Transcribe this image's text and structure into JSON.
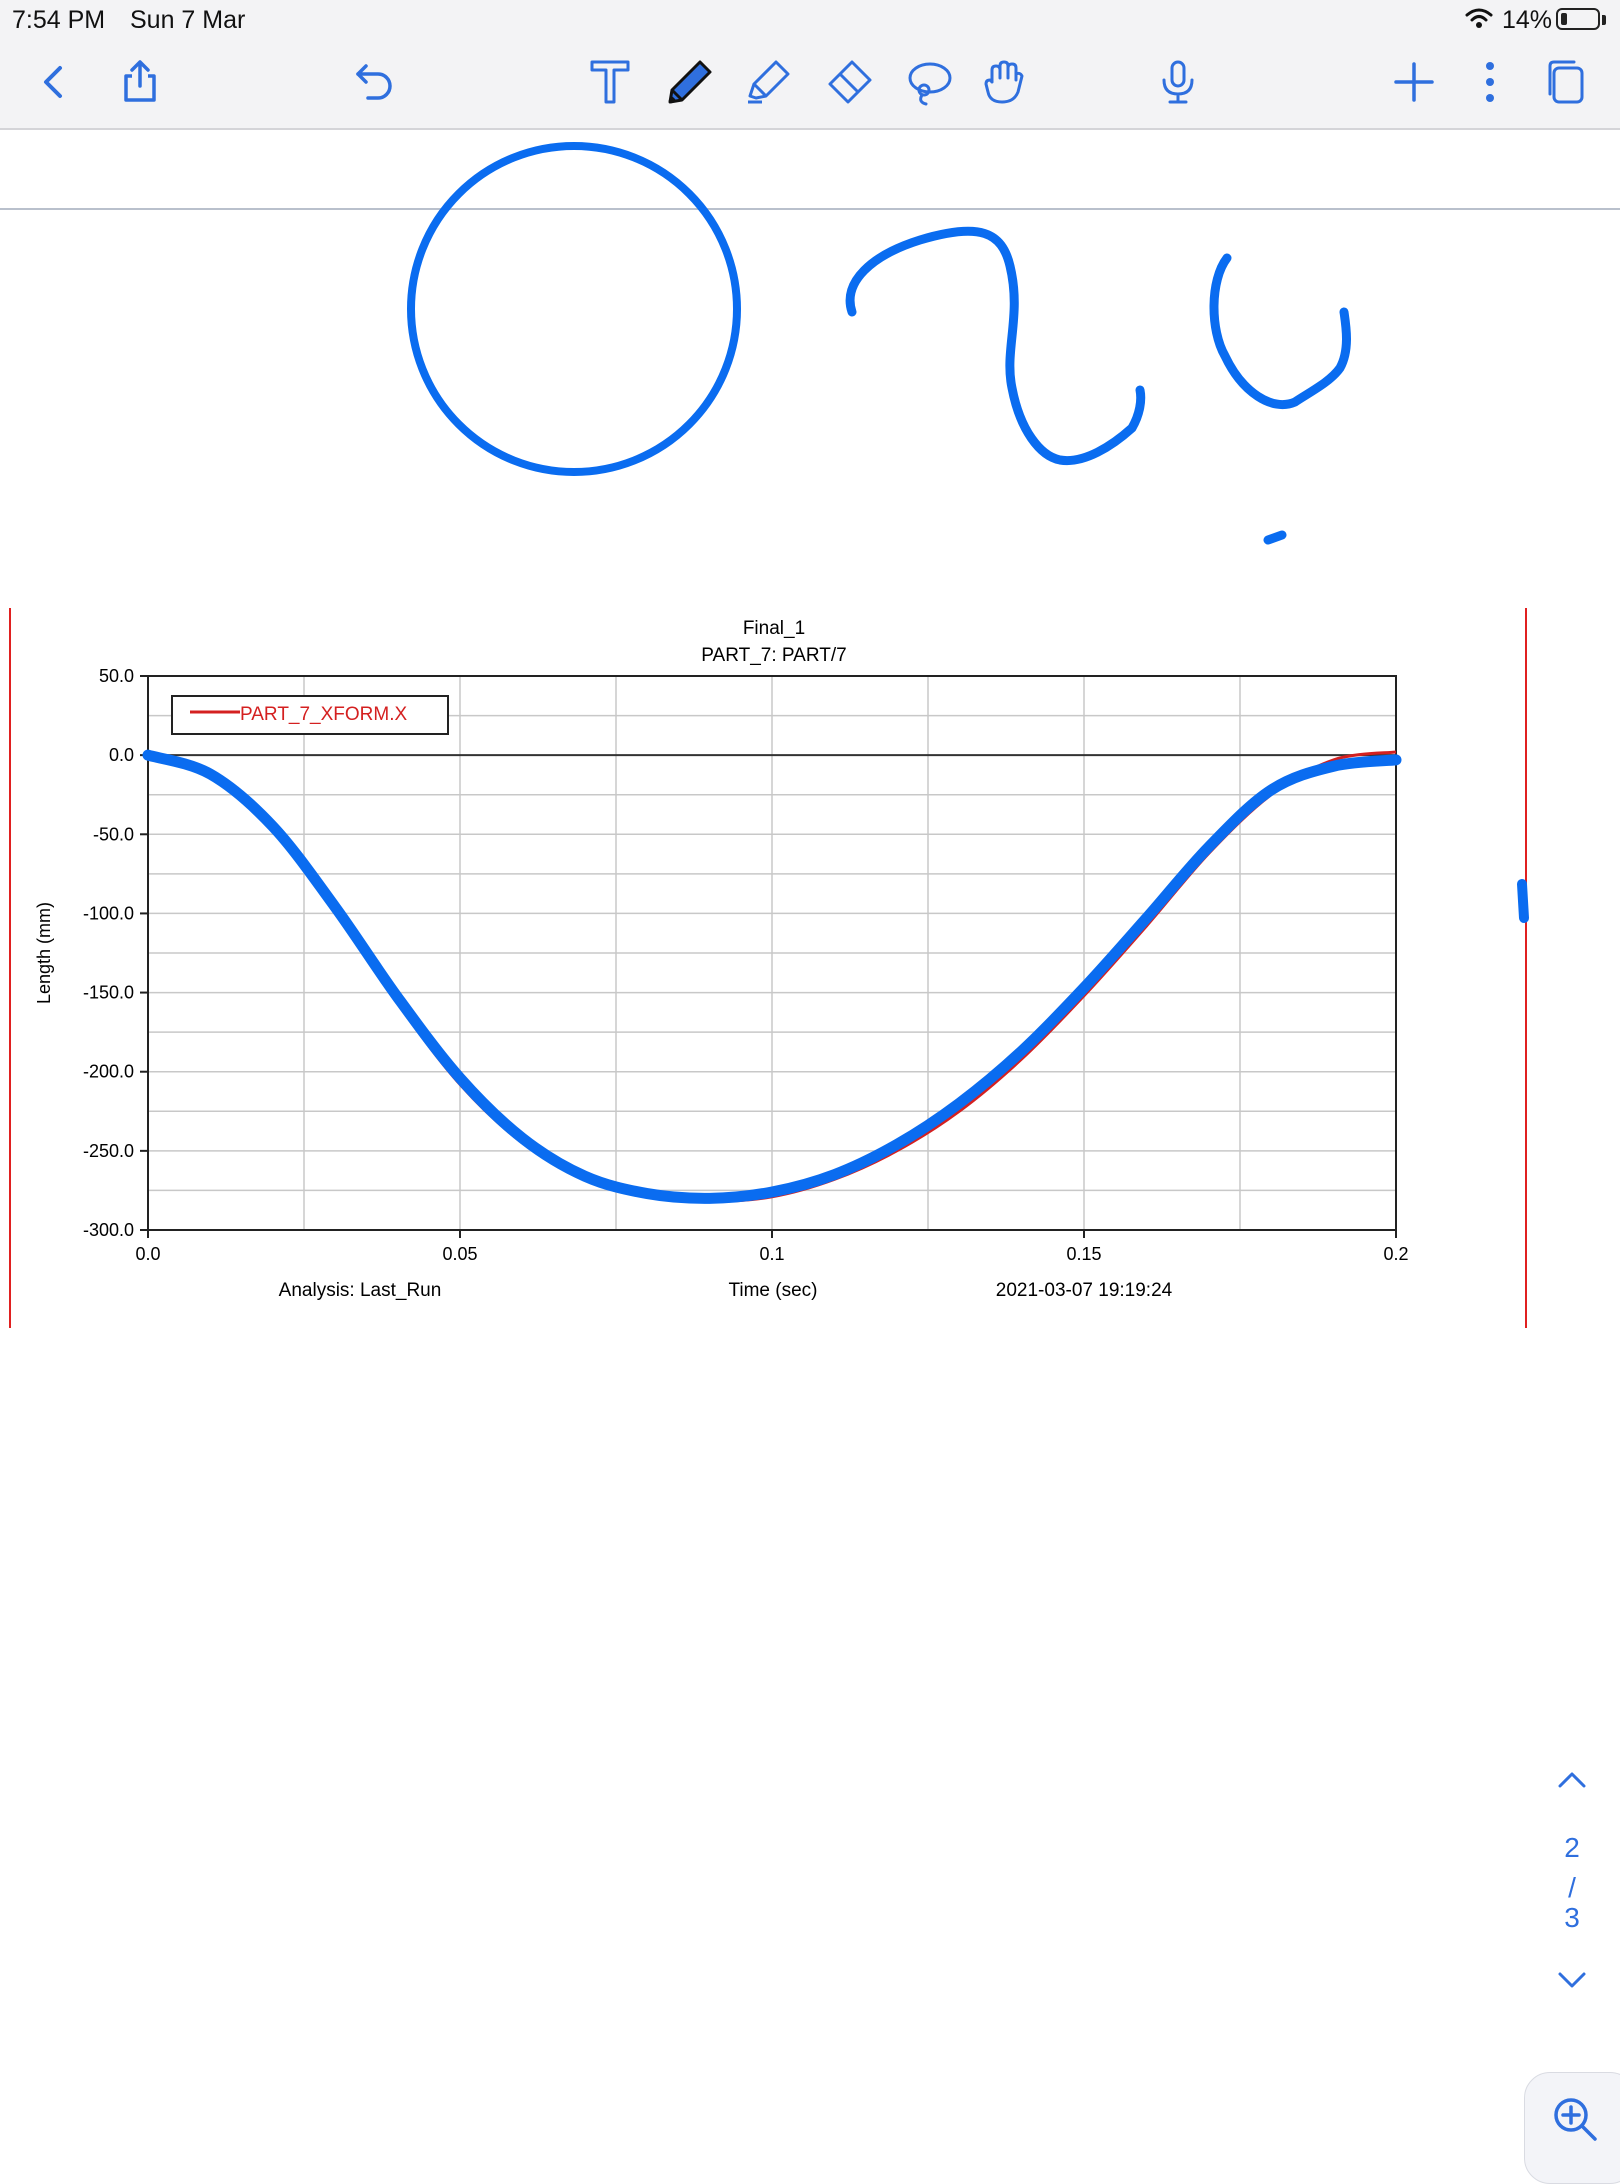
{
  "status_bar": {
    "time": "7:54 PM",
    "date": "Sun 7 Mar",
    "battery": "14%"
  },
  "toolbar": {
    "icons": [
      "back-icon",
      "share-icon",
      "undo-icon",
      "text-tool-icon",
      "pen-tool-icon",
      "highlighter-tool-icon",
      "eraser-tool-icon",
      "lasso-tool-icon",
      "hand-tool-icon",
      "microphone-icon",
      "add-icon",
      "more-icon",
      "pages-icon"
    ],
    "active_tool": "pen",
    "accent": "#0a6cf0"
  },
  "ink": {
    "color": "#0a6cf0",
    "shapes": [
      "circle",
      "two-sketch",
      "u-sketch"
    ]
  },
  "chart_data": {
    "type": "line",
    "title": "Final_1",
    "subtitle": "PART_7: PART/7",
    "xlabel": "Time (sec)",
    "ylabel": "Length (mm)",
    "footer_left": "Analysis:  Last_Run",
    "footer_right": "2021-03-07 19:19:24",
    "xlim": [
      0,
      0.2
    ],
    "ylim": [
      -300,
      50
    ],
    "x_ticks": [
      "0.0",
      "0.05",
      "0.1",
      "0.15",
      "0.2"
    ],
    "x_tick_values": [
      0,
      0.05,
      0.1,
      0.15,
      0.2
    ],
    "y_ticks": [
      "50.0",
      "0.0",
      "-50.0",
      "-100.0",
      "-150.0",
      "-200.0",
      "-250.0",
      "-300.0"
    ],
    "y_tick_values": [
      50,
      0,
      -50,
      -100,
      -150,
      -200,
      -250,
      -300
    ],
    "grid": true,
    "legend_position": "top-left",
    "series": [
      {
        "name": "PART_7_XFORM.X",
        "color": "#d42020",
        "x": [
          0,
          0.01,
          0.02,
          0.03,
          0.04,
          0.05,
          0.06,
          0.07,
          0.08,
          0.09,
          0.1,
          0.11,
          0.12,
          0.13,
          0.14,
          0.15,
          0.16,
          0.17,
          0.18,
          0.19,
          0.2
        ],
        "y": [
          0,
          -13,
          -48,
          -100,
          -157,
          -208,
          -245,
          -268,
          -279,
          -282,
          -279,
          -268,
          -250,
          -225,
          -192,
          -152,
          -108,
          -62,
          -25,
          -3,
          2
        ]
      }
    ],
    "ink_trace": {
      "color": "#0a6cf0",
      "x": [
        0,
        0.01,
        0.02,
        0.03,
        0.04,
        0.05,
        0.06,
        0.07,
        0.08,
        0.09,
        0.1,
        0.11,
        0.12,
        0.13,
        0.14,
        0.15,
        0.16,
        0.17,
        0.18,
        0.19,
        0.2
      ],
      "y": [
        0,
        -12,
        -45,
        -96,
        -153,
        -204,
        -242,
        -266,
        -277,
        -280,
        -276,
        -265,
        -246,
        -220,
        -187,
        -147,
        -103,
        -58,
        -22,
        -7,
        -3
      ]
    }
  },
  "page_nav": {
    "current": "2",
    "separator": "/",
    "total": "3"
  }
}
